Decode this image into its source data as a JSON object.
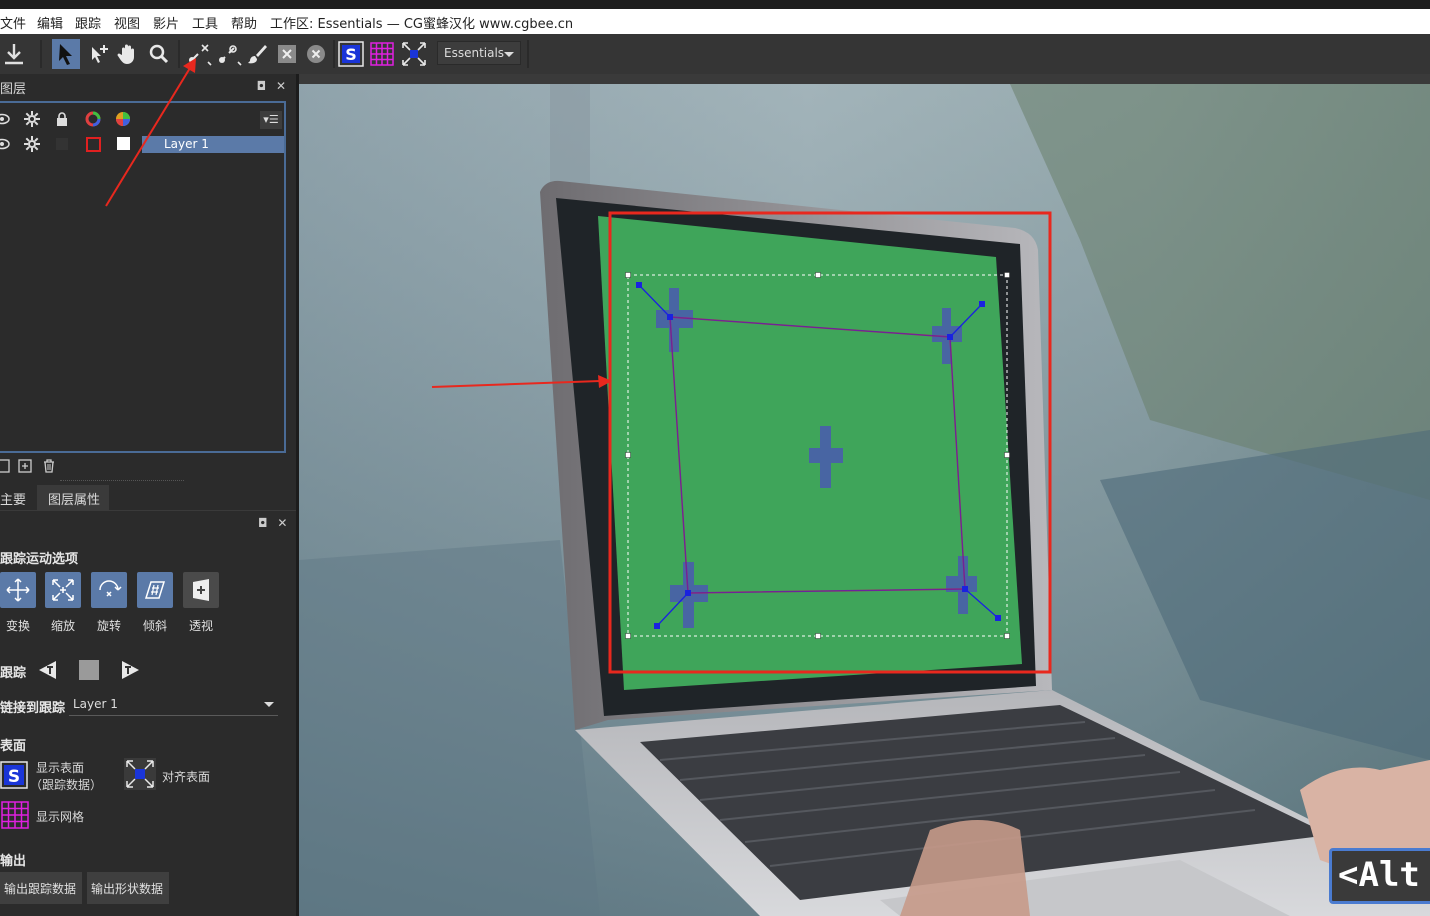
{
  "menu": {
    "items": [
      "文件",
      "编辑",
      "跟踪",
      "视图",
      "影片",
      "工具",
      "帮助"
    ],
    "workspace_title": "工作区: Essentials — CG蜜蜂汉化 www.cgbee.cn"
  },
  "toolbar": {
    "workspace_dropdown": "Essentials",
    "tools": [
      "download-icon",
      "select-arrow-icon",
      "add-point-icon",
      "hand-icon",
      "zoom-icon",
      "link-spline-icon",
      "unlink-spline-icon",
      "brush-icon",
      "x-square-icon",
      "x-circle-icon",
      "surface-s-icon",
      "grid-icon",
      "align-surface-icon"
    ]
  },
  "layers_panel": {
    "title": "图层",
    "layer_name": "Layer 1",
    "menu_glyph": "▾☰"
  },
  "tabs": {
    "main": "主要",
    "layer_props": "图层属性"
  },
  "track_motion": {
    "title": "跟踪运动选项",
    "buttons": [
      "变换",
      "缩放",
      "旋转",
      "倾斜",
      "透视"
    ]
  },
  "track": {
    "title": "跟踪"
  },
  "link": {
    "label": "链接到跟踪",
    "value": "Layer 1"
  },
  "surface": {
    "title": "表面",
    "show_surface": "显示表面",
    "show_surface_sub": "（跟踪数据）",
    "align_surface": "对齐表面",
    "show_grid": "显示网格"
  },
  "output": {
    "title": "输出",
    "export_tracking": "输出跟踪数据",
    "export_shape": "输出形状数据"
  },
  "overlay": {
    "alt_key": "<Alt -"
  },
  "colors": {
    "accent": "#5b7aa8",
    "annotation_red": "#e8281e",
    "screen_green": "#3fa55a",
    "track_blue": "#1a22e0"
  }
}
